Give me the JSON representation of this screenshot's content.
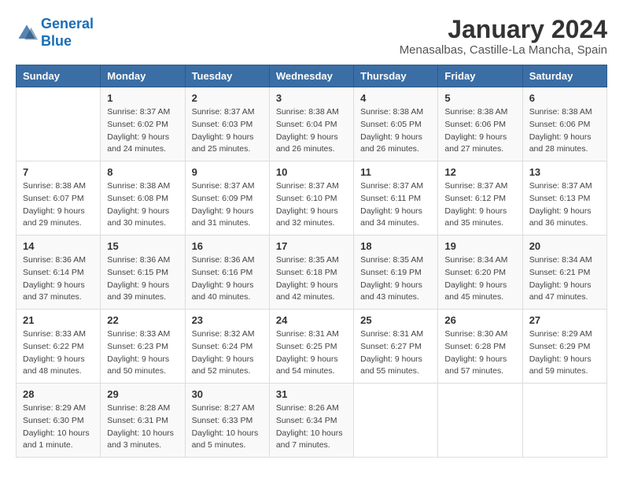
{
  "logo": {
    "line1": "General",
    "line2": "Blue"
  },
  "title": "January 2024",
  "location": "Menasalbas, Castille-La Mancha, Spain",
  "days_of_week": [
    "Sunday",
    "Monday",
    "Tuesday",
    "Wednesday",
    "Thursday",
    "Friday",
    "Saturday"
  ],
  "weeks": [
    [
      {
        "day": "",
        "sunrise": "",
        "sunset": "",
        "daylight": ""
      },
      {
        "day": "1",
        "sunrise": "Sunrise: 8:37 AM",
        "sunset": "Sunset: 6:02 PM",
        "daylight": "Daylight: 9 hours and 24 minutes."
      },
      {
        "day": "2",
        "sunrise": "Sunrise: 8:37 AM",
        "sunset": "Sunset: 6:03 PM",
        "daylight": "Daylight: 9 hours and 25 minutes."
      },
      {
        "day": "3",
        "sunrise": "Sunrise: 8:38 AM",
        "sunset": "Sunset: 6:04 PM",
        "daylight": "Daylight: 9 hours and 26 minutes."
      },
      {
        "day": "4",
        "sunrise": "Sunrise: 8:38 AM",
        "sunset": "Sunset: 6:05 PM",
        "daylight": "Daylight: 9 hours and 26 minutes."
      },
      {
        "day": "5",
        "sunrise": "Sunrise: 8:38 AM",
        "sunset": "Sunset: 6:06 PM",
        "daylight": "Daylight: 9 hours and 27 minutes."
      },
      {
        "day": "6",
        "sunrise": "Sunrise: 8:38 AM",
        "sunset": "Sunset: 6:06 PM",
        "daylight": "Daylight: 9 hours and 28 minutes."
      }
    ],
    [
      {
        "day": "7",
        "sunrise": "Sunrise: 8:38 AM",
        "sunset": "Sunset: 6:07 PM",
        "daylight": "Daylight: 9 hours and 29 minutes."
      },
      {
        "day": "8",
        "sunrise": "Sunrise: 8:38 AM",
        "sunset": "Sunset: 6:08 PM",
        "daylight": "Daylight: 9 hours and 30 minutes."
      },
      {
        "day": "9",
        "sunrise": "Sunrise: 8:37 AM",
        "sunset": "Sunset: 6:09 PM",
        "daylight": "Daylight: 9 hours and 31 minutes."
      },
      {
        "day": "10",
        "sunrise": "Sunrise: 8:37 AM",
        "sunset": "Sunset: 6:10 PM",
        "daylight": "Daylight: 9 hours and 32 minutes."
      },
      {
        "day": "11",
        "sunrise": "Sunrise: 8:37 AM",
        "sunset": "Sunset: 6:11 PM",
        "daylight": "Daylight: 9 hours and 34 minutes."
      },
      {
        "day": "12",
        "sunrise": "Sunrise: 8:37 AM",
        "sunset": "Sunset: 6:12 PM",
        "daylight": "Daylight: 9 hours and 35 minutes."
      },
      {
        "day": "13",
        "sunrise": "Sunrise: 8:37 AM",
        "sunset": "Sunset: 6:13 PM",
        "daylight": "Daylight: 9 hours and 36 minutes."
      }
    ],
    [
      {
        "day": "14",
        "sunrise": "Sunrise: 8:36 AM",
        "sunset": "Sunset: 6:14 PM",
        "daylight": "Daylight: 9 hours and 37 minutes."
      },
      {
        "day": "15",
        "sunrise": "Sunrise: 8:36 AM",
        "sunset": "Sunset: 6:15 PM",
        "daylight": "Daylight: 9 hours and 39 minutes."
      },
      {
        "day": "16",
        "sunrise": "Sunrise: 8:36 AM",
        "sunset": "Sunset: 6:16 PM",
        "daylight": "Daylight: 9 hours and 40 minutes."
      },
      {
        "day": "17",
        "sunrise": "Sunrise: 8:35 AM",
        "sunset": "Sunset: 6:18 PM",
        "daylight": "Daylight: 9 hours and 42 minutes."
      },
      {
        "day": "18",
        "sunrise": "Sunrise: 8:35 AM",
        "sunset": "Sunset: 6:19 PM",
        "daylight": "Daylight: 9 hours and 43 minutes."
      },
      {
        "day": "19",
        "sunrise": "Sunrise: 8:34 AM",
        "sunset": "Sunset: 6:20 PM",
        "daylight": "Daylight: 9 hours and 45 minutes."
      },
      {
        "day": "20",
        "sunrise": "Sunrise: 8:34 AM",
        "sunset": "Sunset: 6:21 PM",
        "daylight": "Daylight: 9 hours and 47 minutes."
      }
    ],
    [
      {
        "day": "21",
        "sunrise": "Sunrise: 8:33 AM",
        "sunset": "Sunset: 6:22 PM",
        "daylight": "Daylight: 9 hours and 48 minutes."
      },
      {
        "day": "22",
        "sunrise": "Sunrise: 8:33 AM",
        "sunset": "Sunset: 6:23 PM",
        "daylight": "Daylight: 9 hours and 50 minutes."
      },
      {
        "day": "23",
        "sunrise": "Sunrise: 8:32 AM",
        "sunset": "Sunset: 6:24 PM",
        "daylight": "Daylight: 9 hours and 52 minutes."
      },
      {
        "day": "24",
        "sunrise": "Sunrise: 8:31 AM",
        "sunset": "Sunset: 6:25 PM",
        "daylight": "Daylight: 9 hours and 54 minutes."
      },
      {
        "day": "25",
        "sunrise": "Sunrise: 8:31 AM",
        "sunset": "Sunset: 6:27 PM",
        "daylight": "Daylight: 9 hours and 55 minutes."
      },
      {
        "day": "26",
        "sunrise": "Sunrise: 8:30 AM",
        "sunset": "Sunset: 6:28 PM",
        "daylight": "Daylight: 9 hours and 57 minutes."
      },
      {
        "day": "27",
        "sunrise": "Sunrise: 8:29 AM",
        "sunset": "Sunset: 6:29 PM",
        "daylight": "Daylight: 9 hours and 59 minutes."
      }
    ],
    [
      {
        "day": "28",
        "sunrise": "Sunrise: 8:29 AM",
        "sunset": "Sunset: 6:30 PM",
        "daylight": "Daylight: 10 hours and 1 minute."
      },
      {
        "day": "29",
        "sunrise": "Sunrise: 8:28 AM",
        "sunset": "Sunset: 6:31 PM",
        "daylight": "Daylight: 10 hours and 3 minutes."
      },
      {
        "day": "30",
        "sunrise": "Sunrise: 8:27 AM",
        "sunset": "Sunset: 6:33 PM",
        "daylight": "Daylight: 10 hours and 5 minutes."
      },
      {
        "day": "31",
        "sunrise": "Sunrise: 8:26 AM",
        "sunset": "Sunset: 6:34 PM",
        "daylight": "Daylight: 10 hours and 7 minutes."
      },
      {
        "day": "",
        "sunrise": "",
        "sunset": "",
        "daylight": ""
      },
      {
        "day": "",
        "sunrise": "",
        "sunset": "",
        "daylight": ""
      },
      {
        "day": "",
        "sunrise": "",
        "sunset": "",
        "daylight": ""
      }
    ]
  ]
}
